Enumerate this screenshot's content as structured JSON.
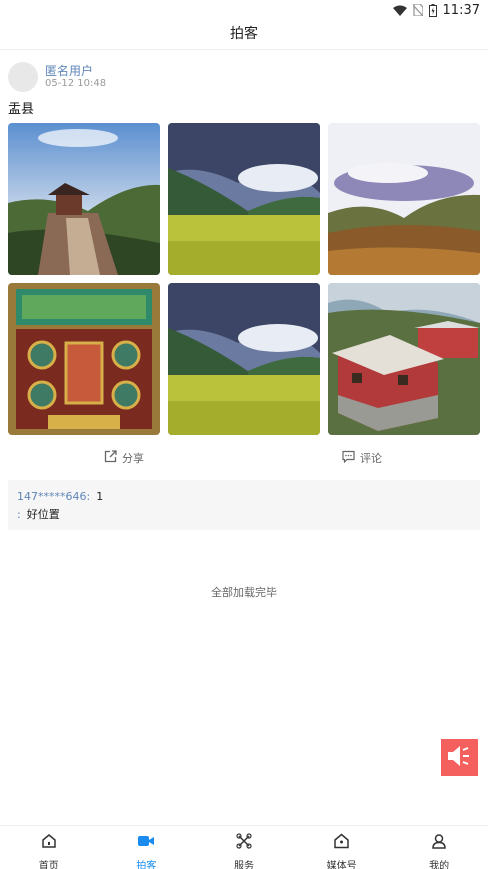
{
  "status_bar": {
    "time": "11:37"
  },
  "header": {
    "title": "拍客"
  },
  "post": {
    "user_name": "匿名用户",
    "time": "05-12 10:48",
    "text": "盂县",
    "photos": [
      {
        "description": "temple-on-hill"
      },
      {
        "description": "green-meadow-clouds"
      },
      {
        "description": "valley-landscape"
      },
      {
        "description": "thangka-painting"
      },
      {
        "description": "green-meadow-clouds"
      },
      {
        "description": "monastery-building"
      }
    ],
    "share_label": "分享",
    "comment_label": "评论",
    "comments": [
      {
        "user": "147*****646",
        "sep": ":",
        "text": "1"
      },
      {
        "user": "",
        "sep": ":",
        "text": "好位置"
      }
    ]
  },
  "footer": {
    "load_complete": "全部加载完毕"
  },
  "colors": {
    "accent": "#1a8cf0",
    "link": "#5f86b8",
    "audio_button": "#f3605e"
  },
  "tabs": [
    {
      "label": "首页",
      "icon": "home-icon",
      "active": false
    },
    {
      "label": "拍客",
      "icon": "video-camera-icon",
      "active": true
    },
    {
      "label": "服务",
      "icon": "service-icon",
      "active": false
    },
    {
      "label": "媒体号",
      "icon": "media-house-icon",
      "active": false
    },
    {
      "label": "我的",
      "icon": "user-icon",
      "active": false
    }
  ]
}
